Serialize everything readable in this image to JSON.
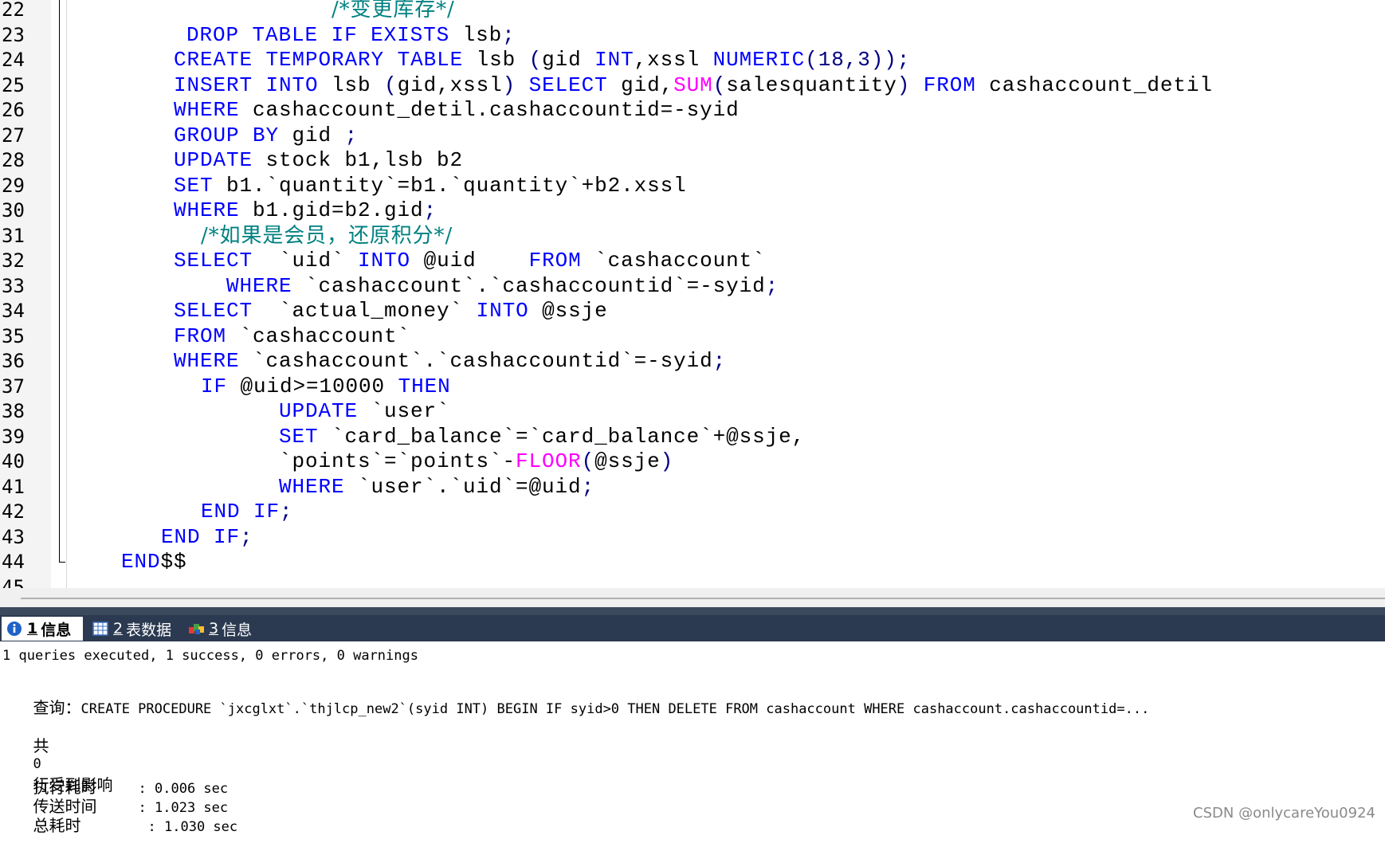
{
  "editor": {
    "lines": [
      {
        "no": "22",
        "indent": 416,
        "tokens": [
          {
            "t": "/*变更库存*/",
            "c": "comment"
          }
        ]
      },
      {
        "no": "23",
        "indent": 234,
        "tokens": [
          {
            "t": "DROP",
            "c": "kw"
          },
          {
            "t": " ",
            "c": "plain"
          },
          {
            "t": "TABLE",
            "c": "kw"
          },
          {
            "t": " ",
            "c": "plain"
          },
          {
            "t": "IF",
            "c": "kw"
          },
          {
            "t": " ",
            "c": "plain"
          },
          {
            "t": "EXISTS",
            "c": "kw"
          },
          {
            "t": " lsb",
            "c": "plain"
          },
          {
            "t": ";",
            "c": "op"
          }
        ]
      },
      {
        "no": "24",
        "indent": 218,
        "tokens": [
          {
            "t": "CREATE",
            "c": "kw"
          },
          {
            "t": " ",
            "c": "plain"
          },
          {
            "t": "TEMPORARY",
            "c": "kw"
          },
          {
            "t": " ",
            "c": "plain"
          },
          {
            "t": "TABLE",
            "c": "kw"
          },
          {
            "t": " lsb ",
            "c": "plain"
          },
          {
            "t": "(",
            "c": "op"
          },
          {
            "t": "gid ",
            "c": "plain"
          },
          {
            "t": "INT",
            "c": "kw"
          },
          {
            "t": ",xssl ",
            "c": "plain"
          },
          {
            "t": "NUMERIC",
            "c": "kw"
          },
          {
            "t": "(18,3));",
            "c": "op"
          }
        ]
      },
      {
        "no": "25",
        "indent": 218,
        "tokens": [
          {
            "t": "INSERT",
            "c": "kw"
          },
          {
            "t": " ",
            "c": "plain"
          },
          {
            "t": "INTO",
            "c": "kw"
          },
          {
            "t": " lsb ",
            "c": "plain"
          },
          {
            "t": "(",
            "c": "op"
          },
          {
            "t": "gid,xssl",
            "c": "plain"
          },
          {
            "t": ")",
            "c": "op"
          },
          {
            "t": " ",
            "c": "plain"
          },
          {
            "t": "SELECT",
            "c": "kw"
          },
          {
            "t": " gid,",
            "c": "plain"
          },
          {
            "t": "SUM",
            "c": "fn"
          },
          {
            "t": "(",
            "c": "op"
          },
          {
            "t": "salesquantity",
            "c": "plain"
          },
          {
            "t": ")",
            "c": "op"
          },
          {
            "t": " ",
            "c": "plain"
          },
          {
            "t": "FROM",
            "c": "kw"
          },
          {
            "t": " cashaccount_detil",
            "c": "plain"
          }
        ]
      },
      {
        "no": "26",
        "indent": 218,
        "tokens": [
          {
            "t": "WHERE",
            "c": "kw"
          },
          {
            "t": " cashaccount_detil.cashaccountid=-syid",
            "c": "plain"
          }
        ]
      },
      {
        "no": "27",
        "indent": 218,
        "tokens": [
          {
            "t": "GROUP",
            "c": "kw"
          },
          {
            "t": " ",
            "c": "plain"
          },
          {
            "t": "BY",
            "c": "kw"
          },
          {
            "t": " gid ",
            "c": "plain"
          },
          {
            "t": ";",
            "c": "op"
          }
        ]
      },
      {
        "no": "28",
        "indent": 218,
        "tokens": [
          {
            "t": "UPDATE",
            "c": "kw"
          },
          {
            "t": " stock b1,lsb b2",
            "c": "plain"
          }
        ]
      },
      {
        "no": "29",
        "indent": 218,
        "tokens": [
          {
            "t": "SET",
            "c": "kw"
          },
          {
            "t": " b1.`quantity`=b1.`quantity`+b2.xssl",
            "c": "plain"
          }
        ]
      },
      {
        "no": "30",
        "indent": 218,
        "tokens": [
          {
            "t": "WHERE",
            "c": "kw"
          },
          {
            "t": " b1.gid=b2.gid",
            "c": "plain"
          },
          {
            "t": ";",
            "c": "op"
          }
        ]
      },
      {
        "no": "31",
        "indent": 252,
        "tokens": [
          {
            "t": "/*如果是会员，还原积分*/",
            "c": "comment"
          }
        ]
      },
      {
        "no": "32",
        "indent": 218,
        "tokens": [
          {
            "t": "SELECT",
            "c": "kw"
          },
          {
            "t": "  `uid` ",
            "c": "plain"
          },
          {
            "t": "INTO",
            "c": "kw"
          },
          {
            "t": " @uid    ",
            "c": "plain"
          },
          {
            "t": "FROM",
            "c": "kw"
          },
          {
            "t": " `cashaccount`",
            "c": "plain"
          }
        ]
      },
      {
        "no": "33",
        "indent": 284,
        "tokens": [
          {
            "t": "WHERE",
            "c": "kw"
          },
          {
            "t": " `cashaccount`.`cashaccountid`=-syid",
            "c": "plain"
          },
          {
            "t": ";",
            "c": "op"
          }
        ]
      },
      {
        "no": "34",
        "indent": 218,
        "tokens": [
          {
            "t": "SELECT",
            "c": "kw"
          },
          {
            "t": "  `actual_money` ",
            "c": "plain"
          },
          {
            "t": "INTO",
            "c": "kw"
          },
          {
            "t": " @ssje",
            "c": "plain"
          }
        ]
      },
      {
        "no": "35",
        "indent": 218,
        "tokens": [
          {
            "t": "FROM",
            "c": "kw"
          },
          {
            "t": " `cashaccount`",
            "c": "plain"
          }
        ]
      },
      {
        "no": "36",
        "indent": 218,
        "tokens": [
          {
            "t": "WHERE",
            "c": "kw"
          },
          {
            "t": " `cashaccount`.`cashaccountid`=-syid",
            "c": "plain"
          },
          {
            "t": ";",
            "c": "op"
          }
        ]
      },
      {
        "no": "37",
        "indent": 252,
        "tokens": [
          {
            "t": "IF",
            "c": "kw"
          },
          {
            "t": " @uid>=10000 ",
            "c": "plain"
          },
          {
            "t": "THEN",
            "c": "kw"
          }
        ]
      },
      {
        "no": "38",
        "indent": 350,
        "tokens": [
          {
            "t": "UPDATE",
            "c": "kw"
          },
          {
            "t": " `user`",
            "c": "plain"
          }
        ]
      },
      {
        "no": "39",
        "indent": 350,
        "tokens": [
          {
            "t": "SET",
            "c": "kw"
          },
          {
            "t": " `card_balance`=`card_balance`+@ssje,",
            "c": "plain"
          }
        ]
      },
      {
        "no": "40",
        "indent": 350,
        "tokens": [
          {
            "t": "`points`=`points`-",
            "c": "plain"
          },
          {
            "t": "FLOOR",
            "c": "fn"
          },
          {
            "t": "(",
            "c": "op"
          },
          {
            "t": "@ssje",
            "c": "plain"
          },
          {
            "t": ")",
            "c": "op"
          }
        ]
      },
      {
        "no": "41",
        "indent": 350,
        "tokens": [
          {
            "t": "WHERE",
            "c": "kw"
          },
          {
            "t": " `user`.`uid`=@uid",
            "c": "plain"
          },
          {
            "t": ";",
            "c": "op"
          }
        ]
      },
      {
        "no": "42",
        "indent": 252,
        "tokens": [
          {
            "t": "END",
            "c": "kw"
          },
          {
            "t": " ",
            "c": "plain"
          },
          {
            "t": "IF",
            "c": "kw"
          },
          {
            "t": ";",
            "c": "op"
          }
        ]
      },
      {
        "no": "43",
        "indent": 202,
        "tokens": [
          {
            "t": "END",
            "c": "kw"
          },
          {
            "t": " ",
            "c": "plain"
          },
          {
            "t": "IF",
            "c": "kw"
          },
          {
            "t": ";",
            "c": "op"
          }
        ]
      },
      {
        "no": "44",
        "indent": 152,
        "tokens": [
          {
            "t": "END",
            "c": "kw"
          },
          {
            "t": "$$",
            "c": "plain"
          }
        ]
      },
      {
        "no": "45",
        "indent": 0,
        "tokens": []
      }
    ]
  },
  "tabs": [
    {
      "num": "1",
      "label": "信息",
      "active": true
    },
    {
      "num": "2",
      "label": "表数据",
      "active": false
    },
    {
      "num": "3",
      "label": "信息",
      "active": false
    }
  ],
  "output": {
    "summary": "1 queries executed, 1 success, 0 errors, 0 warnings",
    "query_label": "查询：",
    "query_text": "CREATE PROCEDURE `jxcglxt`.`thjlcp_new2`(syid INT) BEGIN IF syid>0 THEN DELETE FROM cashaccount WHERE cashaccount.cashaccountid=...",
    "affected_prefix": "共",
    "affected_count": "0",
    "affected_suffix": "行受到影响",
    "timings": [
      {
        "label": "执行耗时",
        "value": ": 0.006 sec"
      },
      {
        "label": "传送时间",
        "value": ": 1.023 sec"
      },
      {
        "label": "总耗时",
        "value": ": 1.030 sec"
      }
    ]
  },
  "watermark": "CSDN @onlycareYou0924",
  "colors": {
    "keyword": "#0000ff",
    "function": "#ff00ff",
    "comment": "#008080",
    "tabbar": "#2b3a50"
  }
}
